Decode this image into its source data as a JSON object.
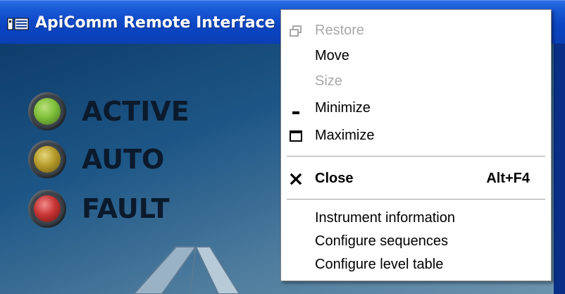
{
  "window": {
    "title": "ApiComm Remote Interface",
    "app_icon": "app-window-icon"
  },
  "status_indicators": [
    {
      "label": "ACTIVE",
      "color": "#7fbf3a",
      "icon": "green-lamp-icon"
    },
    {
      "label": "AUTO",
      "color": "#c9b232",
      "icon": "yellow-lamp-icon"
    },
    {
      "label": "FAULT",
      "color": "#d23a3a",
      "icon": "red-lamp-icon"
    }
  ],
  "system_menu": {
    "items": [
      {
        "label": "Restore",
        "icon": "restore-icon",
        "enabled": false
      },
      {
        "label": "Move",
        "icon": "",
        "enabled": true
      },
      {
        "label": "Size",
        "icon": "",
        "enabled": false
      },
      {
        "label": "Minimize",
        "icon": "minimize-icon",
        "enabled": true
      },
      {
        "label": "Maximize",
        "icon": "maximize-icon",
        "enabled": true
      },
      {
        "label": "Close",
        "icon": "close-icon",
        "enabled": true,
        "accelerator": "Alt+F4"
      },
      {
        "label": "Instrument information",
        "icon": "",
        "enabled": true
      },
      {
        "label": "Configure sequences",
        "icon": "",
        "enabled": true
      },
      {
        "label": "Configure level table",
        "icon": "",
        "enabled": true
      }
    ]
  },
  "colors": {
    "titlebar": "#0c46c4",
    "menu_background": "#ffffff",
    "disabled_text": "#a8a8a8"
  }
}
